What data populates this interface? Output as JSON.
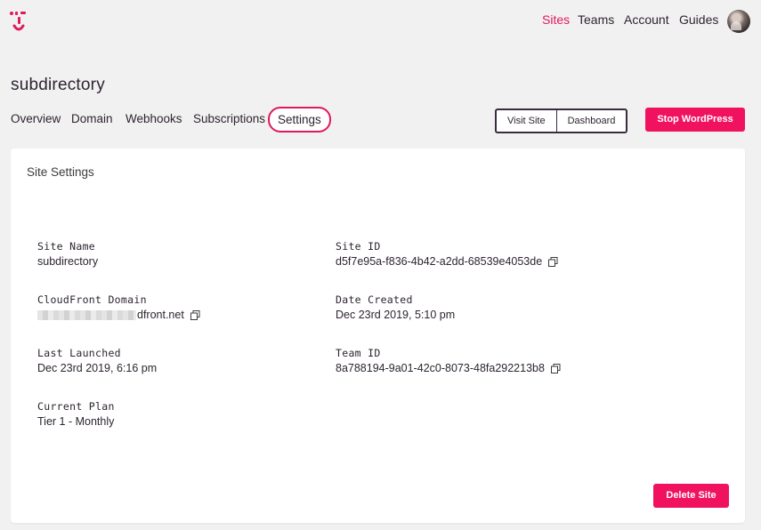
{
  "nav": {
    "links": [
      {
        "label": "Sites",
        "active": true
      },
      {
        "label": "Teams",
        "active": false
      },
      {
        "label": "Account",
        "active": false
      },
      {
        "label": "Guides",
        "active": false
      }
    ]
  },
  "brand": {
    "accent": "#e0195c",
    "dark": "#2d2430"
  },
  "site": {
    "title": "subdirectory"
  },
  "tabs": [
    {
      "label": "Overview"
    },
    {
      "label": "Domain"
    },
    {
      "label": "Webhooks"
    },
    {
      "label": "Subscriptions"
    },
    {
      "label": "Settings",
      "active": true
    }
  ],
  "actions": {
    "visit_site": "Visit Site",
    "dashboard": "Dashboard",
    "stop_wordpress": "Stop WordPress"
  },
  "settings": {
    "title": "Site Settings",
    "site_name": {
      "label": "Site Name",
      "value": "subdirectory"
    },
    "site_id": {
      "label": "Site ID",
      "value": "d5f7e95a-f836-4b42-a2dd-68539e4053de",
      "copyable": true
    },
    "cloudfront_domain": {
      "label": "CloudFront Domain",
      "value": "dfront.net",
      "redacted_prefix": true,
      "copyable": true
    },
    "date_created": {
      "label": "Date Created",
      "value": "Dec 23rd 2019, 5:10 pm"
    },
    "last_launched": {
      "label": "Last Launched",
      "value": "Dec 23rd 2019, 6:16 pm"
    },
    "team_id": {
      "label": "Team ID",
      "value": "8a788194-9a01-42c0-8073-48fa292213b8",
      "copyable": true
    },
    "current_plan": {
      "label": "Current Plan",
      "value": "Tier 1 - Monthly"
    },
    "delete_site": "Delete Site"
  }
}
